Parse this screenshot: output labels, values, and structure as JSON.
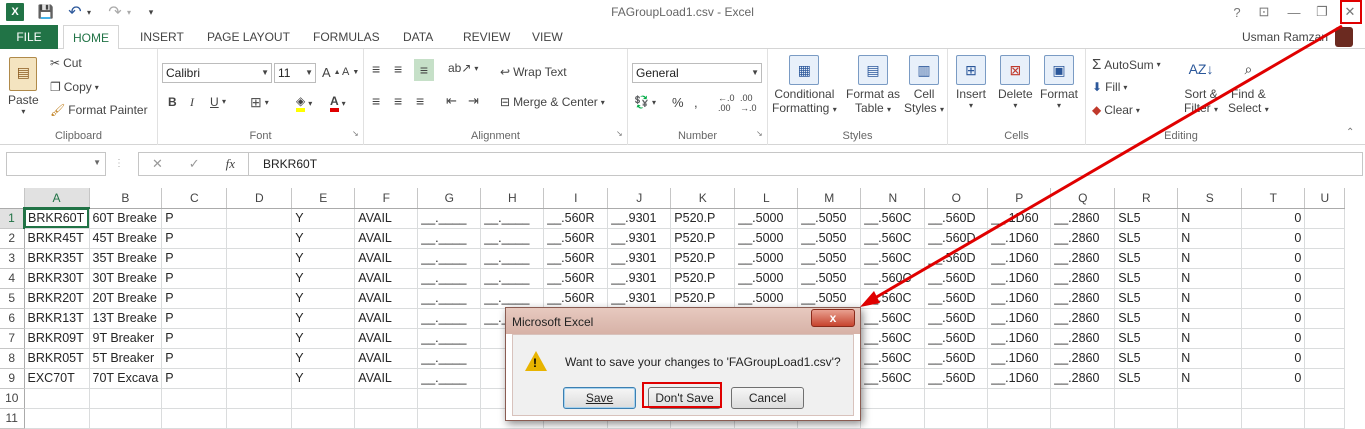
{
  "window": {
    "title": "FAGroupLoad1.csv - Excel"
  },
  "qat": {
    "excel_icon": "X",
    "save": "💾",
    "undo": "↶",
    "redo": "↷",
    "customize": "▾"
  },
  "window_controls": {
    "help": "?",
    "restore_ribbon": "⊡",
    "minimize": "—",
    "maximize": "❐",
    "close": "✕"
  },
  "tabs": {
    "file": "FILE",
    "items": [
      "HOME",
      "INSERT",
      "PAGE LAYOUT",
      "FORMULAS",
      "DATA",
      "REVIEW",
      "VIEW"
    ]
  },
  "user": {
    "name": "Usman Ramzan"
  },
  "ribbon": {
    "clipboard": {
      "label": "Clipboard",
      "paste": "Paste",
      "cut": "Cut",
      "copy": "Copy",
      "format_painter": "Format Painter"
    },
    "font": {
      "label": "Font",
      "family": "Calibri",
      "size": "11"
    },
    "alignment": {
      "label": "Alignment",
      "wrap_text": "Wrap Text",
      "merge_center": "Merge & Center"
    },
    "number": {
      "label": "Number",
      "format": "General"
    },
    "styles": {
      "label": "Styles",
      "conditional_1": "Conditional",
      "conditional_2": "Formatting",
      "format_as_1": "Format as",
      "format_as_2": "Table",
      "cell_styles_1": "Cell",
      "cell_styles_2": "Styles"
    },
    "cells": {
      "label": "Cells",
      "insert": "Insert",
      "delete": "Delete",
      "format": "Format"
    },
    "editing": {
      "label": "Editing",
      "autosum": "AutoSum",
      "fill": "Fill",
      "clear": "Clear",
      "sort_1": "Sort &",
      "sort_2": "Filter",
      "find_1": "Find &",
      "find_2": "Select"
    }
  },
  "formula_bar": {
    "name_box": "",
    "cancel": "✕",
    "enter": "✓",
    "fx": "fx",
    "value": "BRKR60T"
  },
  "sheet": {
    "columns": [
      "A",
      "B",
      "C",
      "D",
      "E",
      "F",
      "G",
      "H",
      "I",
      "J",
      "K",
      "L",
      "M",
      "N",
      "O",
      "P",
      "Q",
      "R",
      "S",
      "T",
      "U"
    ],
    "rows": [
      [
        "1",
        "BRKR60T",
        "60T Breake",
        "P",
        "",
        "Y",
        "AVAIL",
        "__.____",
        "__.____",
        "__.560R",
        "__.9301",
        "P520.P",
        "__.5000",
        "__.5050",
        "__.560C",
        "__.560D",
        "__.1D60",
        "__.2860",
        "SL5",
        "N",
        "0",
        ""
      ],
      [
        "2",
        "BRKR45T",
        "45T Breake",
        "P",
        "",
        "Y",
        "AVAIL",
        "__.____",
        "__.____",
        "__.560R",
        "__.9301",
        "P520.P",
        "__.5000",
        "__.5050",
        "__.560C",
        "__.560D",
        "__.1D60",
        "__.2860",
        "SL5",
        "N",
        "0",
        ""
      ],
      [
        "3",
        "BRKR35T",
        "35T Breake",
        "P",
        "",
        "Y",
        "AVAIL",
        "__.____",
        "__.____",
        "__.560R",
        "__.9301",
        "P520.P",
        "__.5000",
        "__.5050",
        "__.560C",
        "__.560D",
        "__.1D60",
        "__.2860",
        "SL5",
        "N",
        "0",
        ""
      ],
      [
        "4",
        "BRKR30T",
        "30T Breake",
        "P",
        "",
        "Y",
        "AVAIL",
        "__.____",
        "__.____",
        "__.560R",
        "__.9301",
        "P520.P",
        "__.5000",
        "__.5050",
        "__.560C",
        "__.560D",
        "__.1D60",
        "__.2860",
        "SL5",
        "N",
        "0",
        ""
      ],
      [
        "5",
        "BRKR20T",
        "20T Breake",
        "P",
        "",
        "Y",
        "AVAIL",
        "__.____",
        "__.____",
        "__.560R",
        "__.9301",
        "P520.P",
        "__.5000",
        "__.5050",
        "__.560C",
        "__.560D",
        "__.1D60",
        "__.2860",
        "SL5",
        "N",
        "0",
        ""
      ],
      [
        "6",
        "BRKR13T",
        "13T Breake",
        "P",
        "",
        "Y",
        "AVAIL",
        "__.____",
        "__.____",
        "",
        "",
        "",
        "",
        "",
        "__.560C",
        "__.560D",
        "__.1D60",
        "__.2860",
        "SL5",
        "N",
        "0",
        ""
      ],
      [
        "7",
        "BRKR09T",
        "9T Breaker",
        "P",
        "",
        "Y",
        "AVAIL",
        "__.____",
        "",
        "",
        "",
        "",
        "",
        "",
        "__.560C",
        "__.560D",
        "__.1D60",
        "__.2860",
        "SL5",
        "N",
        "0",
        ""
      ],
      [
        "8",
        "BRKR05T",
        "5T Breaker",
        "P",
        "",
        "Y",
        "AVAIL",
        "__.____",
        "",
        "",
        "",
        "",
        "",
        "",
        "__.560C",
        "__.560D",
        "__.1D60",
        "__.2860",
        "SL5",
        "N",
        "0",
        ""
      ],
      [
        "9",
        "EXC70T",
        "70T Excava",
        "P",
        "",
        "Y",
        "AVAIL",
        "__.____",
        "",
        "",
        "",
        "",
        "",
        "",
        "__.560C",
        "__.560D",
        "__.1D60",
        "__.2860",
        "SL5",
        "N",
        "0",
        ""
      ],
      [
        "10",
        "",
        "",
        "",
        "",
        "",
        "",
        "",
        "",
        "",
        "",
        "",
        "",
        "",
        "",
        "",
        "",
        "",
        "",
        "",
        "",
        ""
      ],
      [
        "11",
        "",
        "",
        "",
        "",
        "",
        "",
        "",
        "",
        "",
        "",
        "",
        "",
        "",
        "",
        "",
        "",
        "",
        "",
        "",
        "",
        ""
      ]
    ]
  },
  "dialog": {
    "title": "Microsoft Excel",
    "close": "x",
    "warning_icon": "!",
    "message": "Want to save your changes to 'FAGroupLoad1.csv'?",
    "save": "Save",
    "dont_save": "Don't Save",
    "cancel": "Cancel"
  },
  "annotation": {
    "color": "#e00000"
  }
}
